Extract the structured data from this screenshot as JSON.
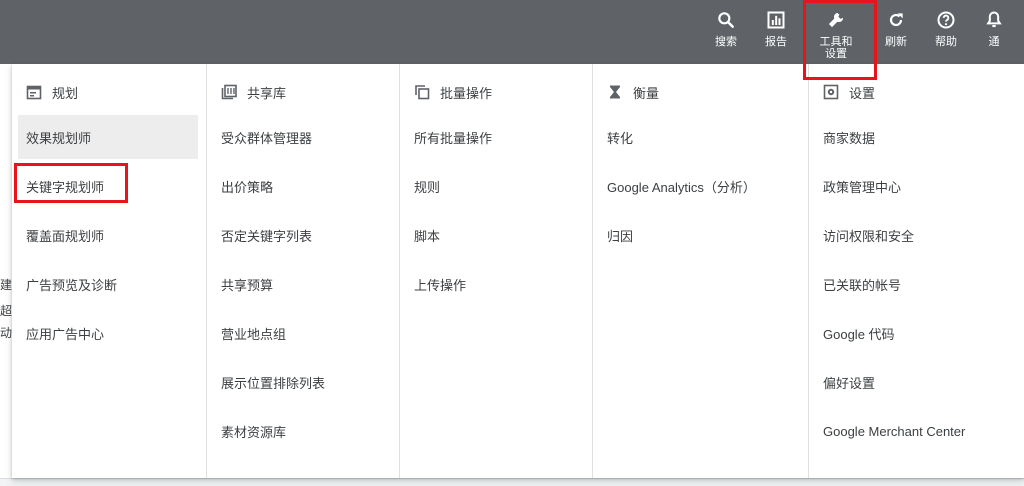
{
  "topbar": {
    "search": "搜索",
    "reports": "报告",
    "tools": "工具和设置",
    "refresh": "刷新",
    "help": "帮助",
    "notifications": "通"
  },
  "background_fragments": [
    "建",
    "超",
    "动"
  ],
  "columns": [
    {
      "heading": "规划",
      "icon": "calendar-icon",
      "items": [
        "效果规划师",
        "关键字规划师",
        "覆盖面规划师",
        "广告预览及诊断",
        "应用广告中心"
      ]
    },
    {
      "heading": "共享库",
      "icon": "library-icon",
      "items": [
        "受众群体管理器",
        "出价策略",
        "否定关键字列表",
        "共享预算",
        "营业地点组",
        "展示位置排除列表",
        "素材资源库"
      ]
    },
    {
      "heading": "批量操作",
      "icon": "copy-icon",
      "items": [
        "所有批量操作",
        "规则",
        "脚本",
        "上传操作"
      ]
    },
    {
      "heading": "衡量",
      "icon": "hourglass-icon",
      "items": [
        "转化",
        "Google Analytics（分析）",
        "归因"
      ]
    },
    {
      "heading": "设置",
      "icon": "settings-icon",
      "items": [
        "商家数据",
        "政策管理中心",
        "访问权限和安全",
        "已关联的帐号",
        "Google 代码",
        "偏好设置",
        "Google Merchant Center"
      ]
    }
  ],
  "colors": {
    "topbar": "#5f6368",
    "highlight": "#e8131b",
    "active_item": "#ededed",
    "text": "#3c4043"
  }
}
